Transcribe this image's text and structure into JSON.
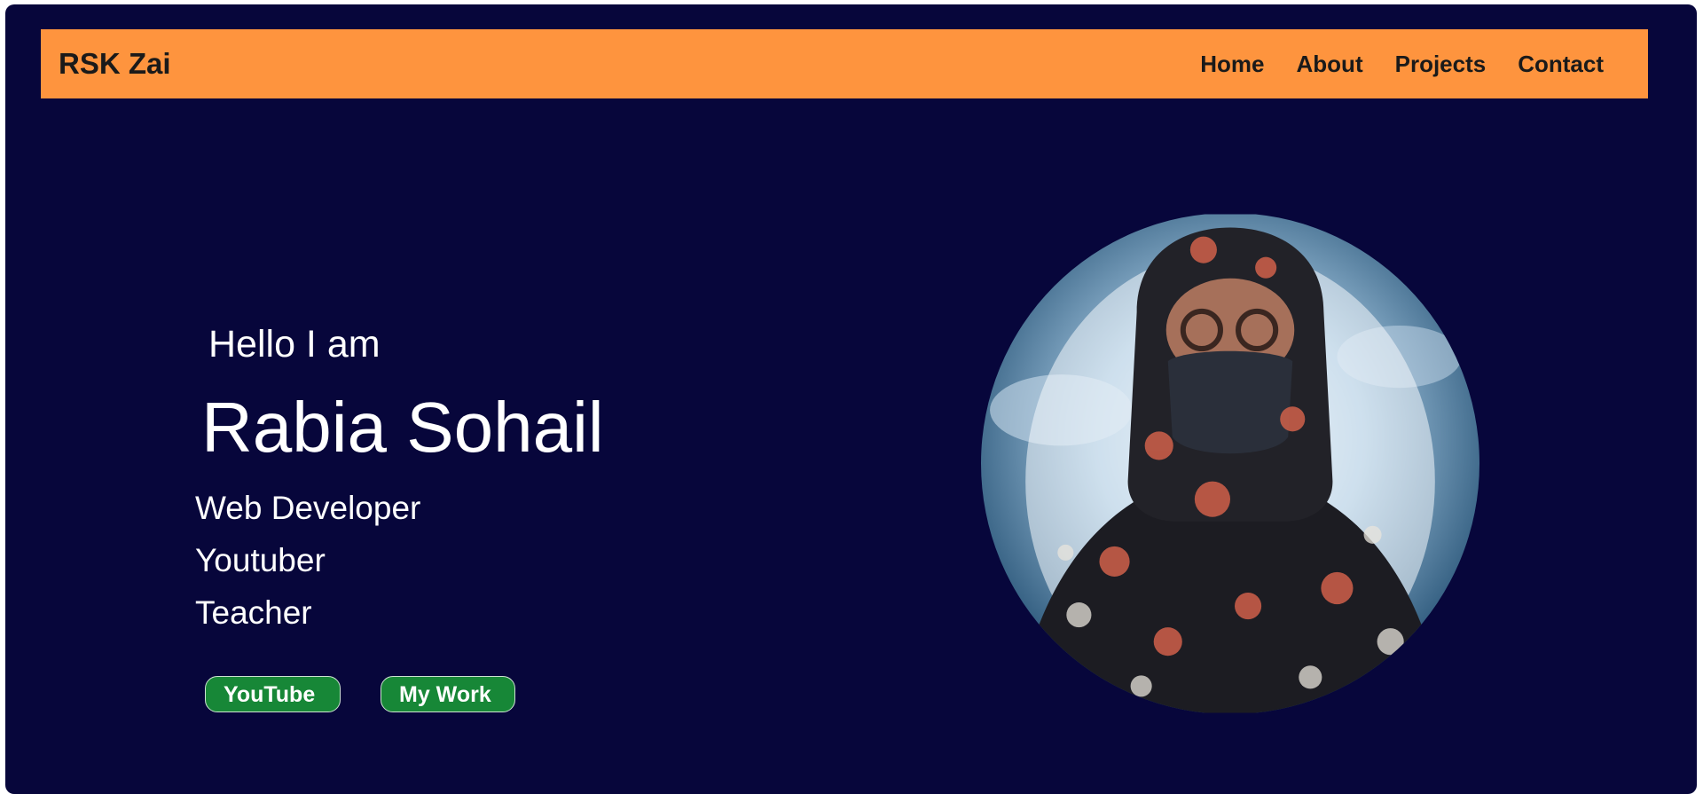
{
  "header": {
    "brand": "RSK Zai",
    "nav": [
      "Home",
      "About",
      "Projects",
      "Contact"
    ]
  },
  "hero": {
    "greeting": "Hello I am",
    "name": "Rabia Sohail",
    "roles": [
      "Web Developer",
      "Youtuber",
      "Teacher"
    ],
    "buttons": {
      "youtube": "YouTube",
      "my_work": "My Work"
    }
  },
  "colors": {
    "background": "#07063b",
    "navbar": "#fe943e",
    "button": "#178737",
    "text": "#ffffff"
  }
}
